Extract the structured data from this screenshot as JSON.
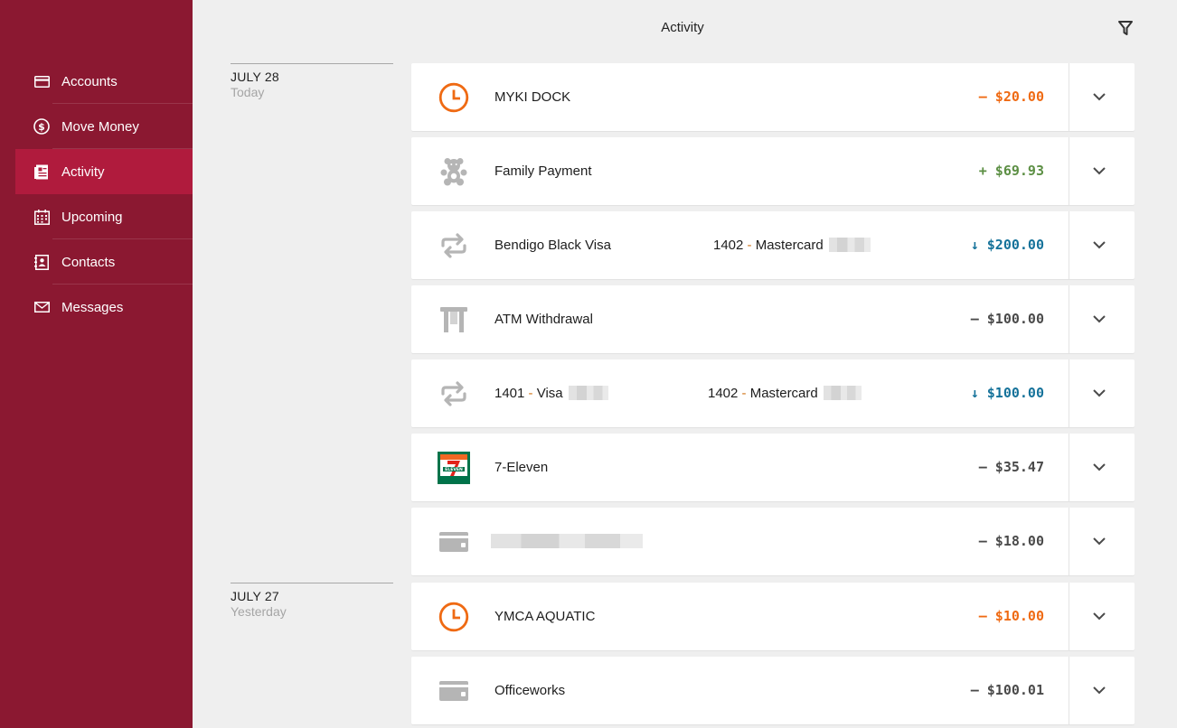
{
  "header": {
    "title": "Activity",
    "filter_icon": "filter-icon"
  },
  "sidebar": {
    "items": [
      {
        "label": "Accounts",
        "icon": "card-icon",
        "active": false
      },
      {
        "label": "Move Money",
        "icon": "dollar-circle-icon",
        "active": false
      },
      {
        "label": "Activity",
        "icon": "document-icon",
        "active": true
      },
      {
        "label": "Upcoming",
        "icon": "calendar-icon",
        "active": false
      },
      {
        "label": "Contacts",
        "icon": "contact-icon",
        "active": false
      },
      {
        "label": "Messages",
        "icon": "envelope-icon",
        "active": false
      }
    ]
  },
  "dates": [
    {
      "date": "JULY 28",
      "relative": "Today"
    },
    {
      "date": "JULY 27",
      "relative": "Yesterday"
    }
  ],
  "transactions": [
    {
      "name": "MYKI DOCK",
      "amount": "– $20.00",
      "icon": "clock-icon",
      "tone": "orange"
    },
    {
      "name": "Family Payment",
      "amount": "+ $69.93",
      "icon": "teddy-bear-icon",
      "tone": "green"
    },
    {
      "name": "Bendigo Black Visa",
      "to_num": "1402",
      "to_sep": " - ",
      "to_name": "Mastercard",
      "amount": "↓ $200.00",
      "icon": "transfer-icon",
      "tone": "blue"
    },
    {
      "name": "ATM Withdrawal",
      "amount": "– $100.00",
      "icon": "atm-icon",
      "tone": "gray"
    },
    {
      "name_num": "1401",
      "name_sep": " - ",
      "name_text": "Visa",
      "to_num": "1402",
      "to_sep": " - ",
      "to_name": "Mastercard",
      "amount": "↓ $100.00",
      "icon": "transfer-icon",
      "tone": "blue"
    },
    {
      "name": "7-Eleven",
      "amount": "– $35.47",
      "icon": "seven-eleven-logo",
      "tone": "gray"
    },
    {
      "name": "",
      "amount": "– $18.00",
      "icon": "card-icon",
      "tone": "gray"
    },
    {
      "name": "YMCA AQUATIC",
      "amount": "– $10.00",
      "icon": "clock-icon",
      "tone": "orange"
    },
    {
      "name": "Officeworks",
      "amount": "– $100.01",
      "icon": "card-icon",
      "tone": "gray"
    }
  ],
  "colors": {
    "sidebar": "#8b1831",
    "sidebar_active": "#b01b3d",
    "orange": "#ef6a13",
    "green": "#5c8f44",
    "blue": "#15729a",
    "gray": "#4a4a4a"
  }
}
